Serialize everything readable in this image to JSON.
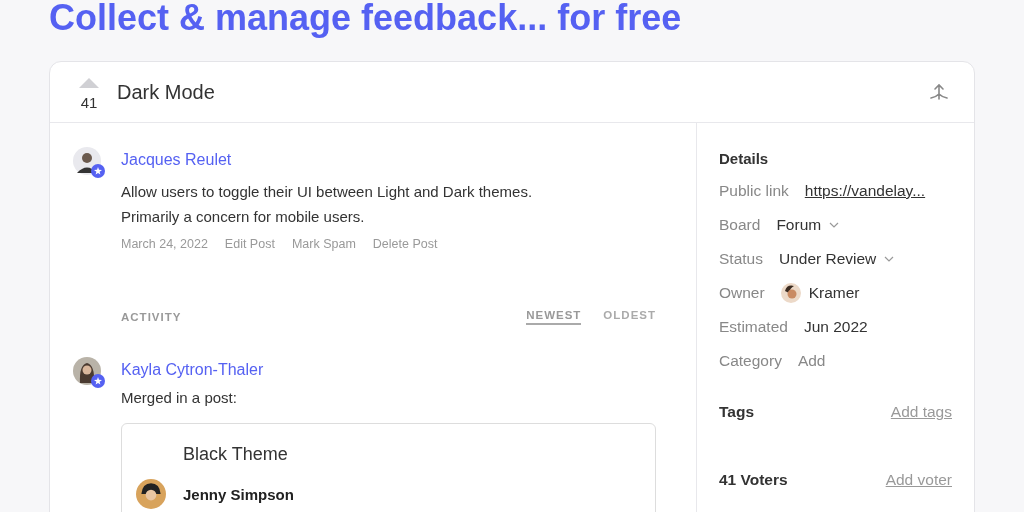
{
  "headline": "Collect & manage feedback... for free",
  "post": {
    "votes": "41",
    "title": "Dark Mode",
    "author": {
      "name": "Jacques Reulet",
      "admin": true
    },
    "body": "Allow users to toggle their UI between Light and Dark themes. Primarily a concern for mobile users.",
    "date": "March 24, 2022",
    "actions": [
      "Edit Post",
      "Mark Spam",
      "Delete Post"
    ]
  },
  "activity": {
    "label": "ACTIVITY",
    "sorts": [
      {
        "label": "NEWEST",
        "selected": true
      },
      {
        "label": "OLDEST",
        "selected": false
      }
    ],
    "entries": [
      {
        "author": "Kayla Cytron-Thaler",
        "admin": true,
        "text": "Merged in a post:",
        "merged": {
          "title": "Black Theme",
          "author": "Jenny Simpson"
        }
      }
    ]
  },
  "details": {
    "heading": "Details",
    "fields": [
      {
        "kind": "link",
        "label": "Public link",
        "value": "https://vandelay..."
      },
      {
        "kind": "dropdown",
        "label": "Board",
        "value": "Forum"
      },
      {
        "kind": "dropdown",
        "label": "Status",
        "value": "Under Review"
      },
      {
        "kind": "person",
        "label": "Owner",
        "value": "Kramer"
      },
      {
        "kind": "text",
        "label": "Estimated",
        "value": "Jun 2022"
      },
      {
        "kind": "add",
        "label": "Category",
        "value": "Add"
      }
    ]
  },
  "tags": {
    "heading": "Tags",
    "action": "Add tags"
  },
  "voters": {
    "heading": "41 Voters",
    "action": "Add voter"
  }
}
